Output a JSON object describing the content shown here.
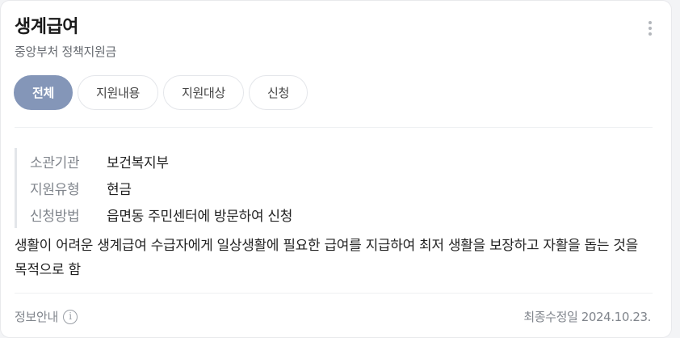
{
  "header": {
    "title": "생계급여",
    "subtitle": "중앙부처 정책지원금"
  },
  "tabs": [
    {
      "label": "전체",
      "active": true
    },
    {
      "label": "지원내용",
      "active": false
    },
    {
      "label": "지원대상",
      "active": false
    },
    {
      "label": "신청",
      "active": false
    }
  ],
  "info": {
    "rows": [
      {
        "key": "소관기관",
        "value": "보건복지부"
      },
      {
        "key": "지원유형",
        "value": "현금"
      },
      {
        "key": "신청방법",
        "value": "읍면동 주민센터에 방문하여 신청"
      }
    ]
  },
  "description": "생활이 어려운 생계급여 수급자에게 일상생활에 필요한 급여를 지급하여 최저 생활을 보장하고 자활을 돕는 것을 목적으로 함",
  "footer": {
    "info_label": "정보안내",
    "info_icon": "i",
    "updated": "최종수정일 2024.10.23."
  },
  "colors": {
    "active_tab": "#8496b8",
    "card_bg": "#ffffff"
  }
}
